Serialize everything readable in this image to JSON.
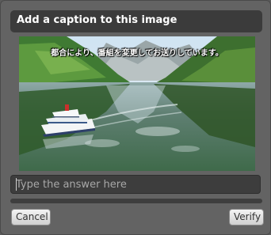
{
  "dialog": {
    "title": "Add a caption to this image",
    "image": {
      "overlay_caption": "都合により、番組を変更してお送りしています。"
    },
    "answer": {
      "placeholder": "Type the answer here",
      "value": ""
    },
    "buttons": {
      "cancel_label": "Cancel",
      "verify_label": "Verify"
    }
  }
}
